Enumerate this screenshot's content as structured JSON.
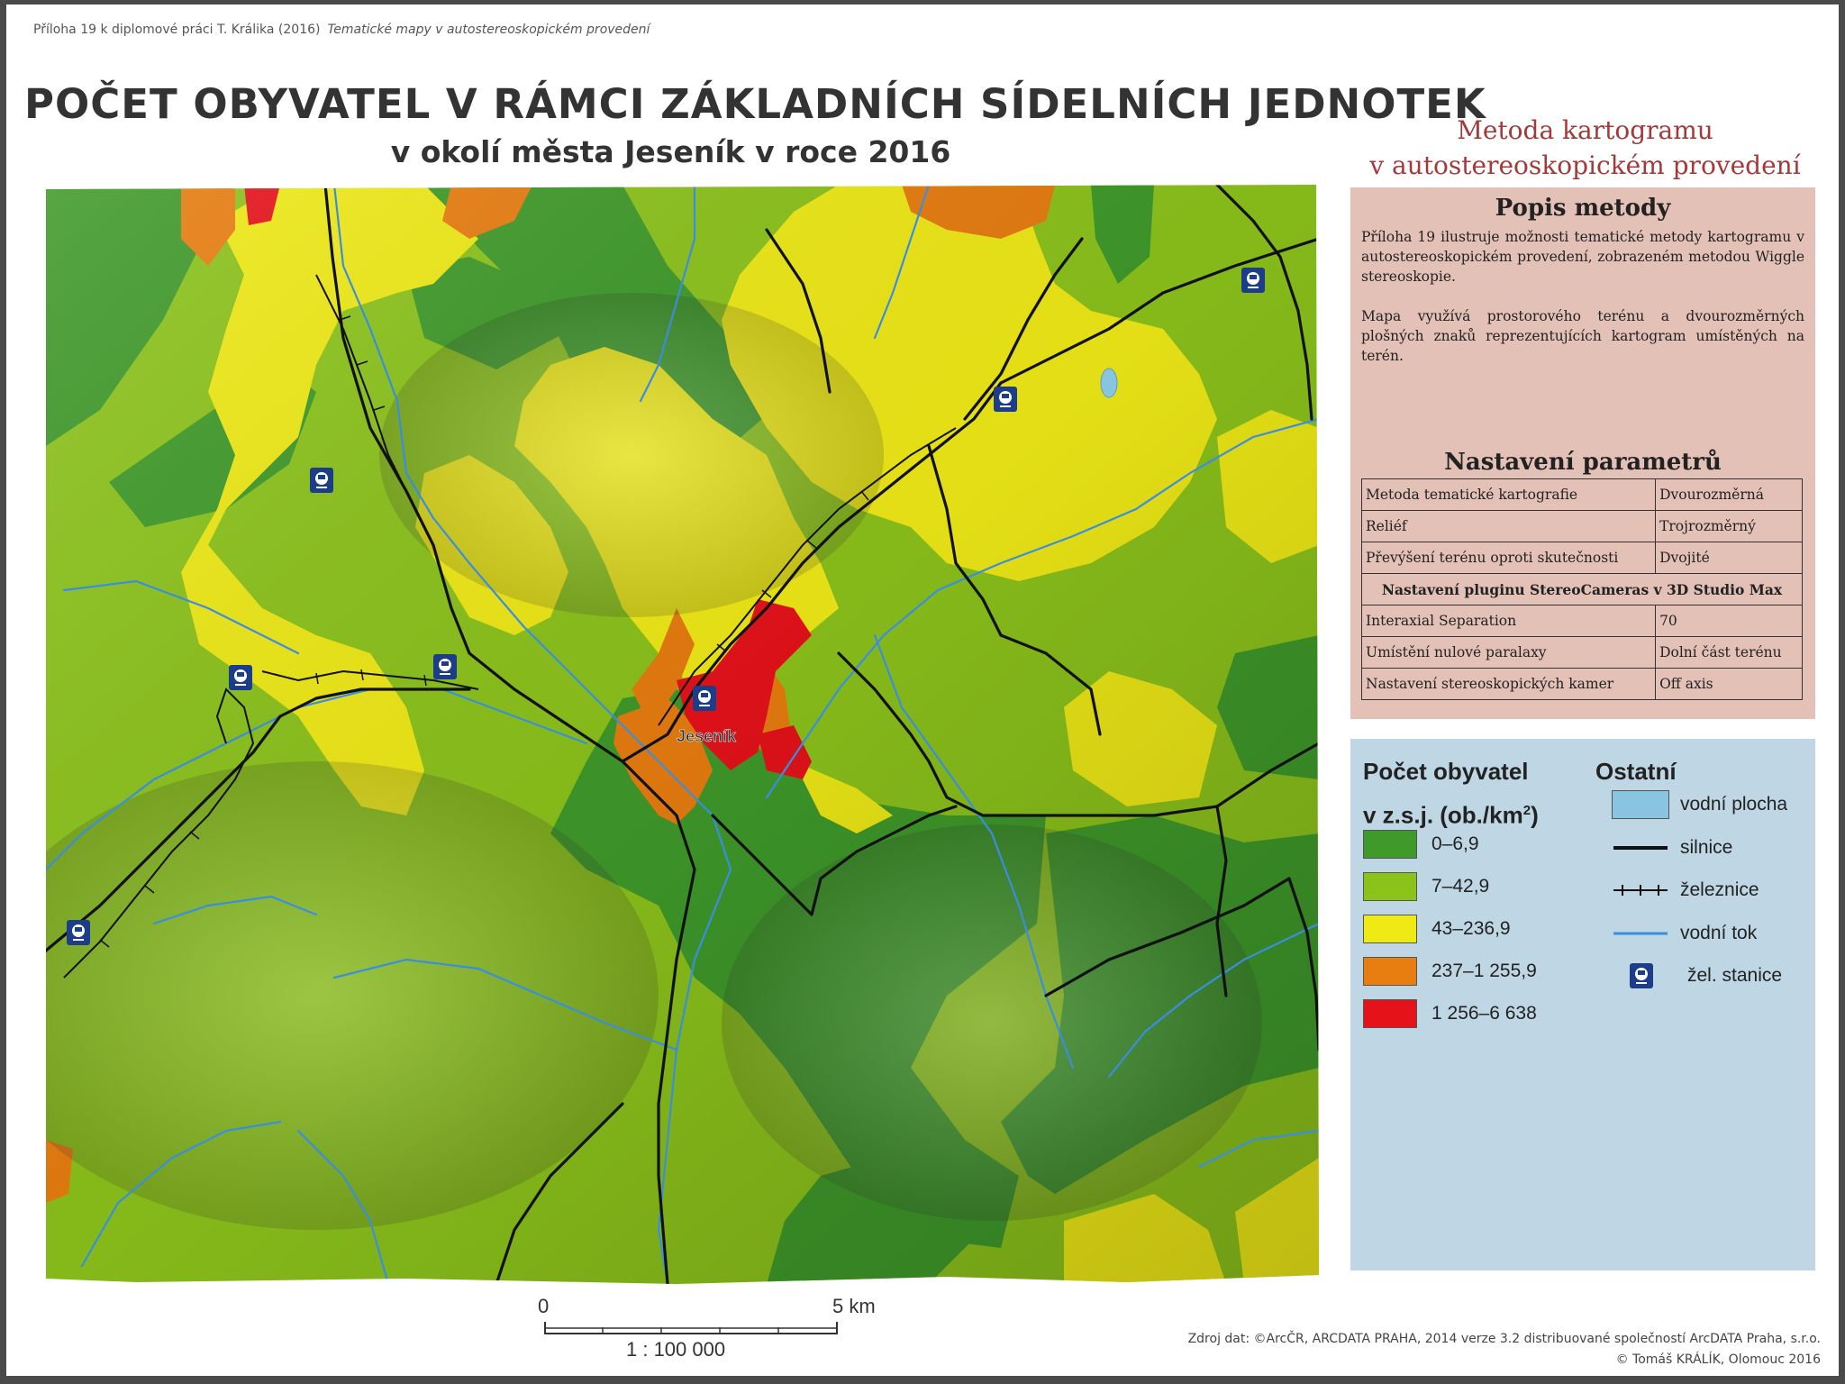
{
  "header": {
    "appendix_note": "Příloha 19 k diplomové práci T. Králika (2016)",
    "appendix_note_italic": "Tematické mapy v autostereoskopickém provedení",
    "title": "POČET OBYVATEL V RÁMCI ZÁKLADNÍCH SÍDELNÍCH JEDNOTEK",
    "subtitle": "v okolí města Jeseník v roce 2016",
    "method_line1": "Metoda kartogramu",
    "method_line2": "v autostereoskopickém provedení"
  },
  "map": {
    "town_label": "Jeseník",
    "colors": {
      "class_1": "#3f9a2a",
      "class_2": "#8cc31b",
      "class_3": "#efea16",
      "class_4": "#e87d10",
      "class_5": "#e6121a",
      "water_area": "#89c5e0",
      "road": "#111111",
      "stream": "#3a8ee0",
      "station": "#1c3e8a"
    }
  },
  "description": {
    "heading": "Popis metody",
    "paragraph1": "Příloha 19 ilustruje možnosti tematické metody kartogramu v autostereoskopickém provedení, zobrazeném metodou Wiggle stereoskopie.",
    "paragraph2": "Mapa využívá prostorového terénu a dvourozměrných plošných znaků reprezentujících kartogram umístěných na terén."
  },
  "parameters": {
    "heading": "Nastavení parametrů",
    "rows": [
      {
        "label": "Metoda tematické kartografie",
        "value": "Dvourozměrná"
      },
      {
        "label": "Reliéf",
        "value": "Trojrozměrný"
      },
      {
        "label": "Převýšení terénu oproti skutečnosti",
        "value": "Dvojité"
      }
    ],
    "plugin_heading": "Nastavení pluginu StereoCameras v 3D Studio Max",
    "plugin_rows": [
      {
        "label": "Interaxial Separation",
        "value": "70"
      },
      {
        "label": "Umístění nulové paralaxy",
        "value": "Dolní část terénu"
      },
      {
        "label": "Nastavení stereoskopických kamer",
        "value": "Off axis"
      }
    ]
  },
  "legend": {
    "population_title_line1": "Počet obyvatel",
    "population_title_line2": "v z.s.j. (ob./km",
    "population_title_sup": "2",
    "population_title_end": ")",
    "classes": [
      {
        "label": "0–6,9",
        "color": "#3f9a2a"
      },
      {
        "label": "7–42,9",
        "color": "#8cc31b"
      },
      {
        "label": "43–236,9",
        "color": "#efea16"
      },
      {
        "label": "237–1 255,9",
        "color": "#e87d10"
      },
      {
        "label": "1 256–6 638",
        "color": "#e6121a"
      }
    ],
    "other_title": "Ostatní",
    "other_items": {
      "water_area": "vodní plocha",
      "road": "silnice",
      "railway": "železnice",
      "stream": "vodní tok",
      "station": "žel. stanice"
    }
  },
  "scale": {
    "start": "0",
    "end": "5 km",
    "ratio": "1 : 100 000"
  },
  "footer": {
    "source": "Zdroj dat: ©ArcČR, ARCDATA PRAHA, 2014 verze 3.2 distribuované společností ArcDATA Praha, s.r.o.",
    "copyright": "© Tomáš KRÁLÍK, Olomouc 2016"
  }
}
